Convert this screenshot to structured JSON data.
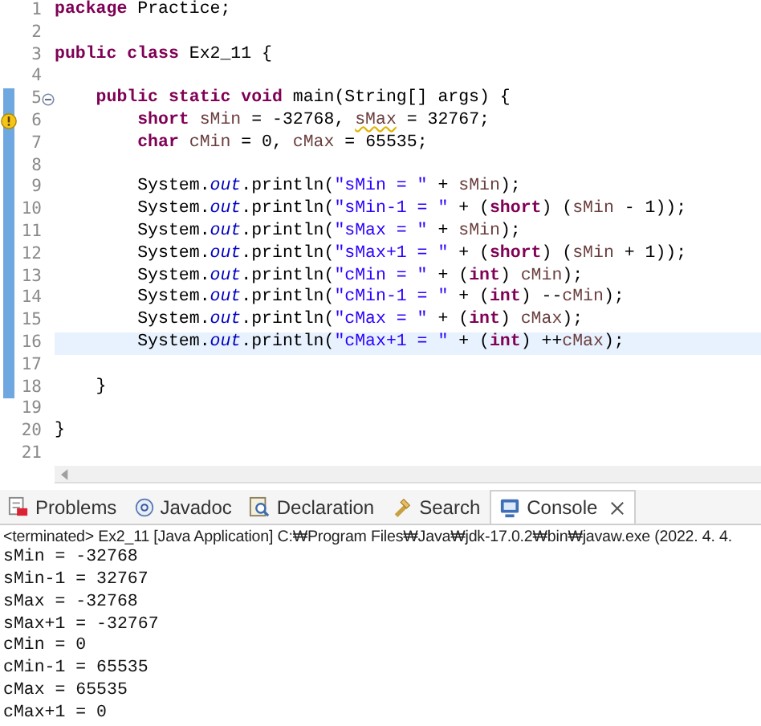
{
  "editor": {
    "lines": [
      {
        "number": "1",
        "tokens": [
          {
            "kind": "kw",
            "text": "package"
          },
          {
            "kind": "plain",
            "text": " Practice;"
          }
        ]
      },
      {
        "number": "2"
      },
      {
        "number": "3",
        "tokens": [
          {
            "kind": "kw",
            "text": "public class"
          },
          {
            "kind": "plain",
            "text": " Ex2_11 {"
          }
        ]
      },
      {
        "number": "4"
      },
      {
        "number": "5",
        "scope": true,
        "fold": true,
        "tokens": [
          {
            "kind": "kw",
            "text": "    public static void"
          },
          {
            "kind": "plain",
            "text": " main(String[] args) {"
          }
        ]
      },
      {
        "number": "6",
        "scope": true,
        "warning": true,
        "tokens": [
          {
            "kind": "kw",
            "text": "        short"
          },
          {
            "kind": "var",
            "text": " sMin"
          },
          {
            "kind": "plain",
            "text": " = -32768, "
          },
          {
            "kind": "warnvar",
            "text": "sMax"
          },
          {
            "kind": "plain",
            "text": " = 32767;"
          }
        ]
      },
      {
        "number": "7",
        "scope": true,
        "tokens": [
          {
            "kind": "kw",
            "text": "        char"
          },
          {
            "kind": "var",
            "text": " cMin"
          },
          {
            "kind": "plain",
            "text": " = 0, "
          },
          {
            "kind": "var",
            "text": "cMax"
          },
          {
            "kind": "plain",
            "text": " = 65535;"
          }
        ]
      },
      {
        "number": "8",
        "scope": true
      },
      {
        "number": "9",
        "scope": true,
        "tokens": [
          {
            "kind": "plain",
            "text": "        System."
          },
          {
            "kind": "field",
            "text": "out"
          },
          {
            "kind": "plain",
            "text": ".println("
          },
          {
            "kind": "str",
            "text": "\"sMin = \""
          },
          {
            "kind": "plain",
            "text": " + "
          },
          {
            "kind": "var",
            "text": "sMin"
          },
          {
            "kind": "plain",
            "text": ");"
          }
        ]
      },
      {
        "number": "10",
        "scope": true,
        "tokens": [
          {
            "kind": "plain",
            "text": "        System."
          },
          {
            "kind": "field",
            "text": "out"
          },
          {
            "kind": "plain",
            "text": ".println("
          },
          {
            "kind": "str",
            "text": "\"sMin-1 = \""
          },
          {
            "kind": "plain",
            "text": " + ("
          },
          {
            "kind": "kw",
            "text": "short"
          },
          {
            "kind": "plain",
            "text": ") ("
          },
          {
            "kind": "var",
            "text": "sMin"
          },
          {
            "kind": "plain",
            "text": " - 1));"
          }
        ]
      },
      {
        "number": "11",
        "scope": true,
        "tokens": [
          {
            "kind": "plain",
            "text": "        System."
          },
          {
            "kind": "field",
            "text": "out"
          },
          {
            "kind": "plain",
            "text": ".println("
          },
          {
            "kind": "str",
            "text": "\"sMax = \""
          },
          {
            "kind": "plain",
            "text": " + "
          },
          {
            "kind": "var",
            "text": "sMin"
          },
          {
            "kind": "plain",
            "text": ");"
          }
        ]
      },
      {
        "number": "12",
        "scope": true,
        "tokens": [
          {
            "kind": "plain",
            "text": "        System."
          },
          {
            "kind": "field",
            "text": "out"
          },
          {
            "kind": "plain",
            "text": ".println("
          },
          {
            "kind": "str",
            "text": "\"sMax+1 = \""
          },
          {
            "kind": "plain",
            "text": " + ("
          },
          {
            "kind": "kw",
            "text": "short"
          },
          {
            "kind": "plain",
            "text": ") ("
          },
          {
            "kind": "var",
            "text": "sMin"
          },
          {
            "kind": "plain",
            "text": " + 1));"
          }
        ]
      },
      {
        "number": "13",
        "scope": true,
        "tokens": [
          {
            "kind": "plain",
            "text": "        System."
          },
          {
            "kind": "field",
            "text": "out"
          },
          {
            "kind": "plain",
            "text": ".println("
          },
          {
            "kind": "str",
            "text": "\"cMin = \""
          },
          {
            "kind": "plain",
            "text": " + ("
          },
          {
            "kind": "kw",
            "text": "int"
          },
          {
            "kind": "plain",
            "text": ") "
          },
          {
            "kind": "var",
            "text": "cMin"
          },
          {
            "kind": "plain",
            "text": ");"
          }
        ]
      },
      {
        "number": "14",
        "scope": true,
        "tokens": [
          {
            "kind": "plain",
            "text": "        System."
          },
          {
            "kind": "field",
            "text": "out"
          },
          {
            "kind": "plain",
            "text": ".println("
          },
          {
            "kind": "str",
            "text": "\"cMin-1 = \""
          },
          {
            "kind": "plain",
            "text": " + ("
          },
          {
            "kind": "kw",
            "text": "int"
          },
          {
            "kind": "plain",
            "text": ") --"
          },
          {
            "kind": "var",
            "text": "cMin"
          },
          {
            "kind": "plain",
            "text": ");"
          }
        ]
      },
      {
        "number": "15",
        "scope": true,
        "tokens": [
          {
            "kind": "plain",
            "text": "        System."
          },
          {
            "kind": "field",
            "text": "out"
          },
          {
            "kind": "plain",
            "text": ".println("
          },
          {
            "kind": "str",
            "text": "\"cMax = \""
          },
          {
            "kind": "plain",
            "text": " + ("
          },
          {
            "kind": "kw",
            "text": "int"
          },
          {
            "kind": "plain",
            "text": ") "
          },
          {
            "kind": "var",
            "text": "cMax"
          },
          {
            "kind": "plain",
            "text": ");"
          }
        ]
      },
      {
        "number": "16",
        "scope": true,
        "current": true,
        "tokens": [
          {
            "kind": "plain",
            "text": "        System."
          },
          {
            "kind": "field",
            "text": "out"
          },
          {
            "kind": "plain",
            "text": ".println("
          },
          {
            "kind": "str",
            "text": "\"cMax+1 = \""
          },
          {
            "kind": "plain",
            "text": " + ("
          },
          {
            "kind": "kw",
            "text": "int"
          },
          {
            "kind": "plain",
            "text": ") ++"
          },
          {
            "kind": "var",
            "text": "cMax"
          },
          {
            "kind": "plain",
            "text": ");"
          }
        ]
      },
      {
        "number": "17",
        "scope": true
      },
      {
        "number": "18",
        "scope": true,
        "tokens": [
          {
            "kind": "plain",
            "text": "    }"
          }
        ]
      },
      {
        "number": "19"
      },
      {
        "number": "20",
        "tokens": [
          {
            "kind": "plain",
            "text": "}"
          }
        ]
      },
      {
        "number": "21"
      }
    ]
  },
  "views": {
    "tabs": [
      {
        "kind": "problems",
        "label": "Problems",
        "selected": false
      },
      {
        "kind": "javadoc",
        "label": "Javadoc",
        "selected": false
      },
      {
        "kind": "declaration",
        "label": "Declaration",
        "selected": false
      },
      {
        "kind": "search",
        "label": "Search",
        "selected": false
      },
      {
        "kind": "console",
        "label": "Console",
        "selected": true,
        "closable": true
      }
    ]
  },
  "console": {
    "status": "<terminated> Ex2_11 [Java Application] C:₩Program Files₩Java₩jdk-17.0.2₩bin₩javaw.exe (2022. 4. 4.",
    "output": [
      "sMin = -32768",
      "sMin-1 = 32767",
      "sMax = -32768",
      "sMax+1 = -32767",
      "cMin = 0",
      "cMin-1 = 65535",
      "cMax = 65535",
      "cMax+1 = 0"
    ]
  }
}
